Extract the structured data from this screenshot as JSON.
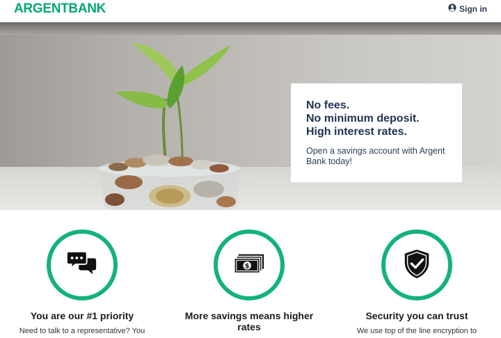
{
  "header": {
    "logo_part1": "ARGENT",
    "logo_part2": "BANK",
    "signin_label": "Sign in"
  },
  "hero": {
    "promo_lines": [
      "No fees.",
      "No minimum deposit.",
      "High interest rates."
    ],
    "promo_text": "Open a savings account with Argent Bank today!"
  },
  "features": [
    {
      "icon": "chat-icon",
      "title": "You are our #1 priority",
      "desc": "Need to talk to a representative? You"
    },
    {
      "icon": "money-icon",
      "title": "More savings means higher rates",
      "desc": ""
    },
    {
      "icon": "shield-check-icon",
      "title": "Security you can trust",
      "desc": "We use top of the line encryption to"
    }
  ],
  "colors": {
    "brand_green": "#00a86b",
    "ring_green": "#14b27a",
    "heading_navy": "#1f3350"
  }
}
